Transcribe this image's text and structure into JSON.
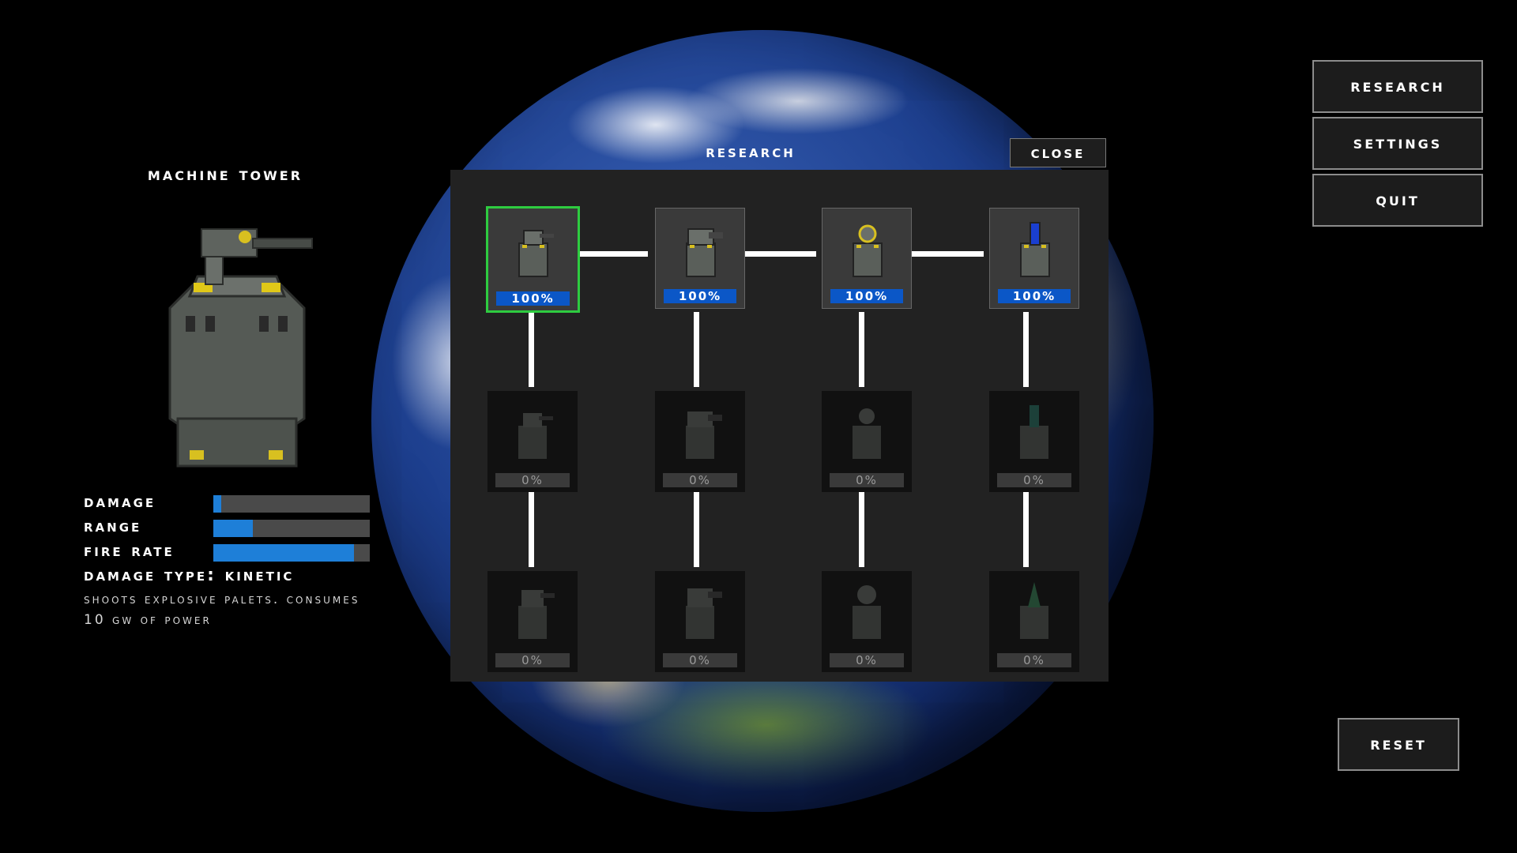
{
  "tower": {
    "name": "Machine Tower",
    "stats": [
      {
        "label": "Damage",
        "level": 0.05
      },
      {
        "label": "Range",
        "level": 0.25
      },
      {
        "label": "Fire Rate",
        "level": 0.9
      }
    ],
    "damage_type": "Damage type: Kinetic",
    "description": "Shoots explosive palets. Consumes 10 Gw of power"
  },
  "research": {
    "title": "Research",
    "close_label": "Close",
    "rows": [
      [
        "100%",
        "100%",
        "100%",
        "100%"
      ],
      [
        "0%",
        "0%",
        "0%",
        "0%"
      ],
      [
        "0%",
        "0%",
        "0%",
        "0%"
      ]
    ],
    "accent_colors": {
      "progress_fill": "#0b57c7",
      "selected_outline": "#2ecc40",
      "stat_fill": "#1e7fd8"
    }
  },
  "menu": {
    "research_label": "Research",
    "settings_label": "Settings",
    "quit_label": "Quit",
    "reset_label": "Reset"
  }
}
